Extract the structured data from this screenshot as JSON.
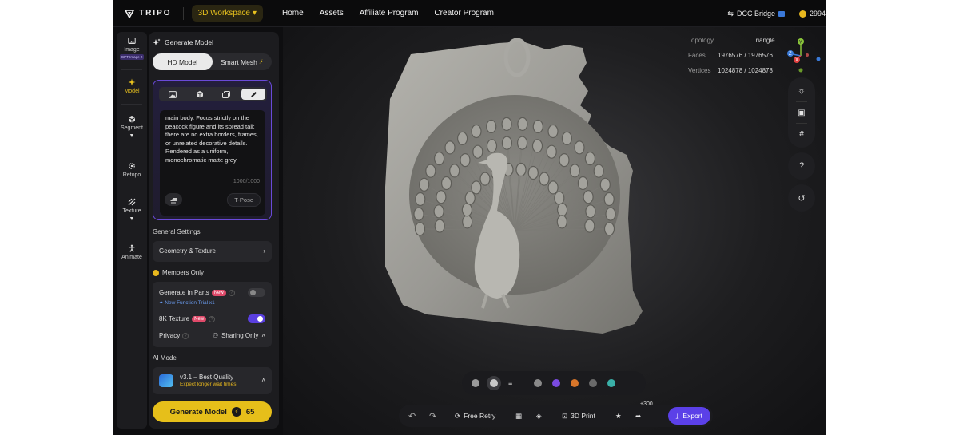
{
  "topbar": {
    "brand": "TRIPO",
    "workspace": "3D Workspace",
    "nav": [
      "Home",
      "Assets",
      "Affiliate Program",
      "Creator Program"
    ],
    "dcc_bridge": "DCC Bridge",
    "credits": "2994"
  },
  "rail": {
    "items": [
      {
        "label": "Image",
        "badge": "GPT Image 2"
      },
      {
        "label": "Model"
      },
      {
        "label": "Segment"
      },
      {
        "label": "Retopo"
      },
      {
        "label": "Texture"
      },
      {
        "label": "Animate"
      }
    ]
  },
  "panel": {
    "title": "Generate Model",
    "tabs": [
      "HD Model",
      "Smart Mesh"
    ],
    "prompt_text": "main body. Focus strictly on the peacock figure and its spread tail; there are no extra borders, frames, or unrelated decorative details. Rendered as a uniform, monochromatic matte grey",
    "char_count": "1000/1000",
    "tpose": "T-Pose",
    "general_settings": "General Settings",
    "geometry_texture": "Geometry & Texture",
    "members_only": "Members Only",
    "generate_in_parts": "Generate in Parts",
    "new_badge": "New",
    "new_function_trial": "New Function Trial x1",
    "texture_8k": "8K Texture",
    "privacy": "Privacy",
    "sharing": "Sharing Only",
    "ai_model": "AI Model",
    "model_version": "v3.1 – Best Quality",
    "model_note": "Expect longer wait times",
    "generate_btn": "Generate Model",
    "generate_cost": "65",
    "toggles": {
      "generate_in_parts": false,
      "texture_8k": true
    }
  },
  "viewport": {
    "stats": {
      "topology_label": "Topology",
      "topology_value": "Triangle",
      "faces_label": "Faces",
      "faces_value": "1976576 / 1976576",
      "vertices_label": "Vertices",
      "vertices_value": "1024878 / 1024878"
    },
    "axis_labels": {
      "y": "Y",
      "x": "X",
      "z": "Z"
    },
    "material_colors": [
      "#9a9a9a",
      "#c8c8c8",
      "#8a8a8a",
      "#7a4ae0",
      "#d8762a",
      "#6a6a6a",
      "#3ab0a8"
    ],
    "actions": {
      "free_retry": "Free Retry",
      "print": "3D Print",
      "share_bonus": "+300",
      "export": "Export"
    }
  }
}
